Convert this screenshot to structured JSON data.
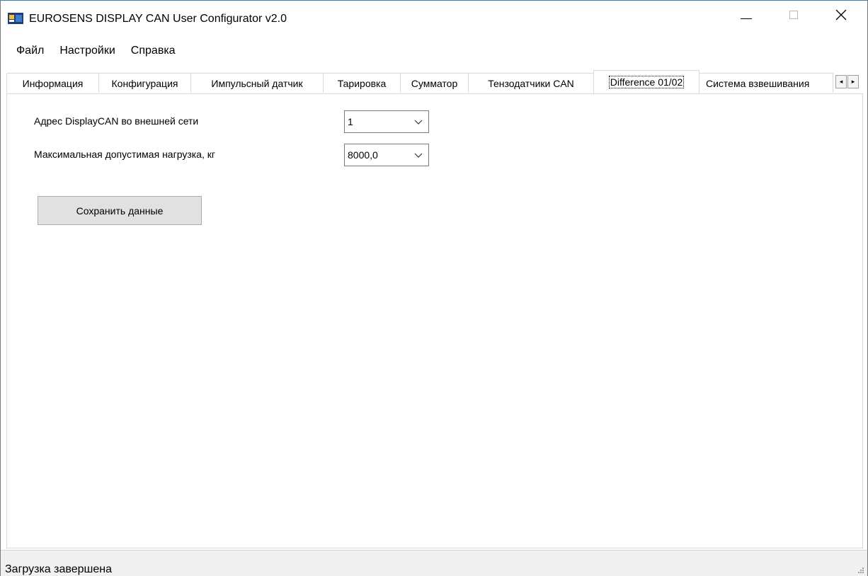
{
  "window": {
    "title": "EUROSENS DISPLAY CAN User Configurator v2.0",
    "controls": {
      "minimize": "minimize",
      "maximize": "maximize",
      "close": "✕"
    }
  },
  "menu": [
    {
      "label": "Файл"
    },
    {
      "label": "Настройки"
    },
    {
      "label": "Справка"
    }
  ],
  "tabs": [
    {
      "label": "Информация",
      "active": false
    },
    {
      "label": "Конфигурация",
      "active": false
    },
    {
      "label": "Импульсный датчик",
      "active": false
    },
    {
      "label": "Тарировка",
      "active": false
    },
    {
      "label": "Сумматор",
      "active": false
    },
    {
      "label": "Тензодатчики CAN",
      "active": false
    },
    {
      "label": "Difference 01/02",
      "active": true
    },
    {
      "label": "Система взвешивания",
      "active": false
    }
  ],
  "tab_scroll": {
    "left": "◂",
    "right": "▸"
  },
  "form": {
    "address_label": "Адрес DisplayCAN во внешней сети",
    "address_value": "1",
    "max_load_label": "Максимальная допустимая нагрузка, кг",
    "max_load_value": "8000,0",
    "save_label": "Сохранить данные"
  },
  "status": {
    "text": "Загрузка завершена"
  },
  "icons": {
    "app": "app-logo-icon",
    "chevron": "chevron-down-icon",
    "grip": "resize-grip-icon"
  },
  "colors": {
    "accent_border": "#3c7fb1",
    "button_bg": "#e1e1e1",
    "status_bg": "#f0f0f0"
  }
}
